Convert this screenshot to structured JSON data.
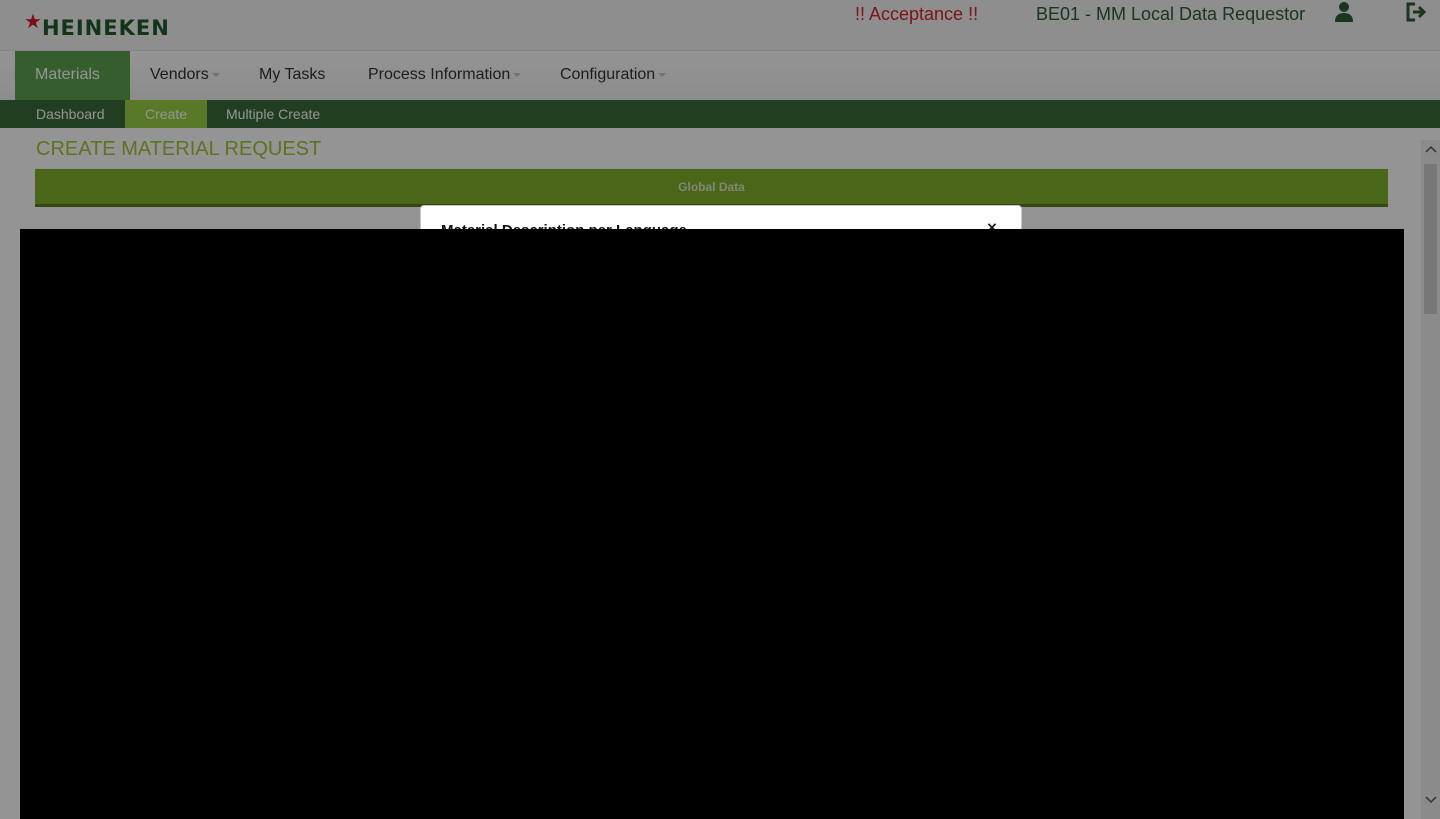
{
  "header": {
    "logo_text": "HEINEKEN",
    "environment": "!! Acceptance !!",
    "user_role": "BE01 - MM Local Data Requestor",
    "icons": [
      "user-icon",
      "logout-icon"
    ]
  },
  "nav": {
    "items": [
      {
        "label": "Materials",
        "active": true,
        "dropdown": true
      },
      {
        "label": "Vendors",
        "active": false,
        "dropdown": true
      },
      {
        "label": "My Tasks",
        "active": false,
        "dropdown": false
      },
      {
        "label": "Process Information",
        "active": false,
        "dropdown": true
      },
      {
        "label": "Configuration",
        "active": false,
        "dropdown": true
      }
    ]
  },
  "subnav": {
    "items": [
      {
        "label": "Dashboard",
        "active": false
      },
      {
        "label": "Create",
        "active": true
      },
      {
        "label": "Multiple Create",
        "active": false
      }
    ]
  },
  "page": {
    "title": "CREATE MATERIAL REQUEST",
    "section_label": "Global Data"
  },
  "modal": {
    "title": "Material Description per Language",
    "close_label": "×"
  },
  "colors": {
    "brand_green": "#2c5d34",
    "accent_green": "#7fb02c",
    "alert_red": "#d8232a"
  }
}
